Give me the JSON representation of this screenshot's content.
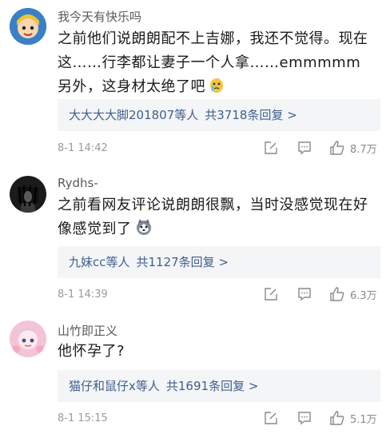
{
  "comments": [
    {
      "username": "我今天有快乐吗",
      "text": "之前他们说朗朗配不上吉娜，我还不觉得。现在这……行李都让妻子一个人拿……emmmmm另外，这身材太绝了吧",
      "emoji": "crying-face-emoji",
      "replies_names": "大大大大脚201807等人",
      "replies_count": "共3718条回复 >",
      "time": "8-1 14:42",
      "likes": "8.7万"
    },
    {
      "username": "Rydhs-",
      "text": "之前看网友评论说朗朗很飘，当时没感觉现在好像感觉到了",
      "emoji": "husky-dog-emoji",
      "replies_names": "九妹cc等人",
      "replies_count": "共1127条回复 >",
      "time": "8-1 14:39",
      "likes": "6.3万"
    },
    {
      "username": "山竹即正义",
      "text": "他怀孕了?",
      "emoji": "",
      "replies_names": "猫仔和鼠仔x等人",
      "replies_count": "共1691条回复 >",
      "time": "8-1 15:15",
      "likes": "5.1万"
    }
  ]
}
